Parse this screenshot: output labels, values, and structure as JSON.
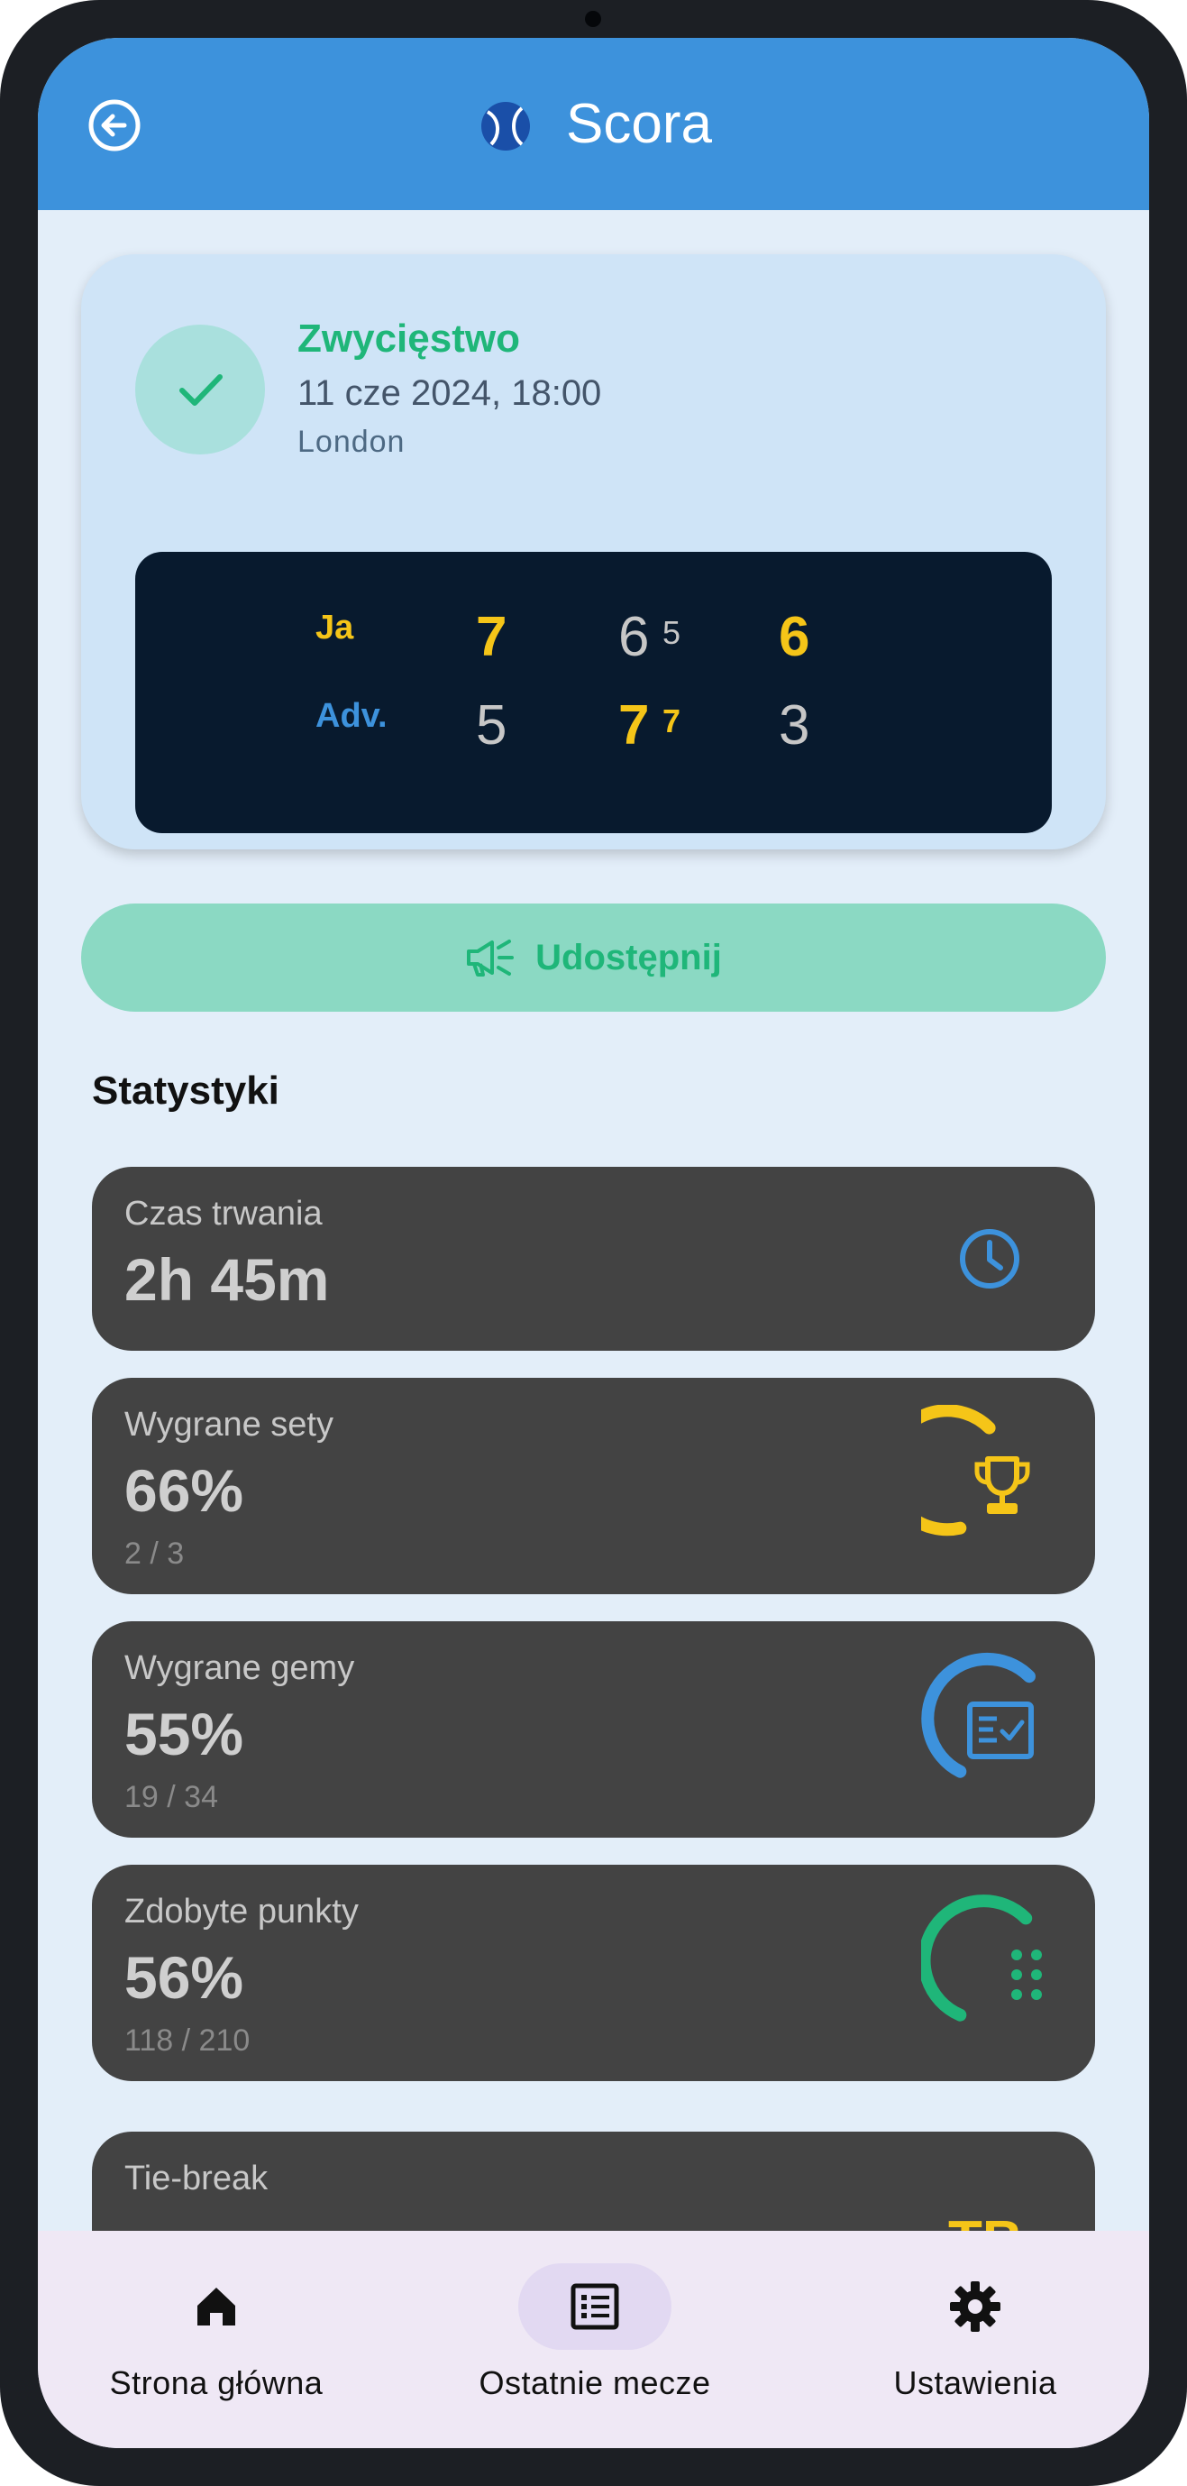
{
  "header": {
    "title": "Scora",
    "back_icon": "back-arrow-circle-icon",
    "logo_icon": "tennis-ball-icon",
    "bar_color": "#3d92dc"
  },
  "match": {
    "result": "Zwycięstwo",
    "result_icon": "check-icon",
    "date": "11 cze 2024, 18:00",
    "location": "London",
    "scoreboard": {
      "player_label": "Ja",
      "opponent_label": "Adv.",
      "player_sets": [
        {
          "games": "7",
          "tiebreak": ""
        },
        {
          "games": "6",
          "tiebreak": "5"
        },
        {
          "games": "6",
          "tiebreak": ""
        }
      ],
      "opponent_sets": [
        {
          "games": "5",
          "tiebreak": ""
        },
        {
          "games": "7",
          "tiebreak": "7"
        },
        {
          "games": "3",
          "tiebreak": ""
        }
      ],
      "winner_color": "#f5c518",
      "loser_color": "#c7c7c7",
      "opponent_label_color": "#3d92dc"
    }
  },
  "share": {
    "label": "Udostępnij",
    "icon": "megaphone-icon",
    "color": "#1fb679"
  },
  "stats": {
    "title": "Statystyki",
    "duration": {
      "label": "Czas trwania",
      "value": "2h 45m",
      "icon": "clock-icon"
    },
    "sets_won": {
      "label": "Wygrane sety",
      "value": "66%",
      "detail": "2 / 3",
      "icon": "trophy-icon",
      "progress": 0.66,
      "color": "#f5c518"
    },
    "games_won": {
      "label": "Wygrane gemy",
      "value": "55%",
      "detail": "19 / 34",
      "icon": "checklist-icon",
      "progress": 0.55,
      "color": "#3d92dc"
    },
    "points_won": {
      "label": "Zdobyte punkty",
      "value": "56%",
      "detail": "118 / 210",
      "icon": "dots-grid-icon",
      "progress": 0.56,
      "color": "#1fb679"
    },
    "tiebreak": {
      "label": "Tie-break",
      "icon_text": "TB"
    }
  },
  "bottom_nav": {
    "items": [
      {
        "label": "Strona główna",
        "icon": "home-icon",
        "active": false
      },
      {
        "label": "Ostatnie mecze",
        "icon": "list-icon",
        "active": true
      },
      {
        "label": "Ustawienia",
        "icon": "gear-icon",
        "active": false
      }
    ]
  }
}
